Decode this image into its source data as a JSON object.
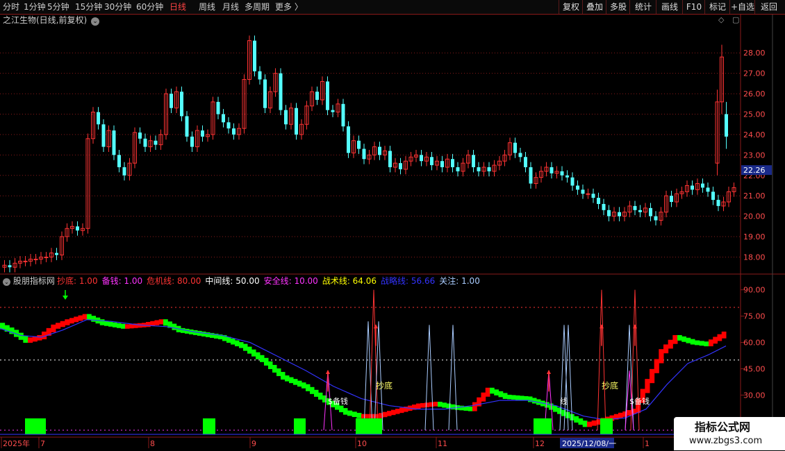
{
  "toolbar": {
    "periods": [
      {
        "label": "分时",
        "active": false
      },
      {
        "label": "1分钟",
        "active": false
      },
      {
        "label": "5分钟",
        "active": false
      },
      {
        "label": "15分钟",
        "active": false
      },
      {
        "label": "30分钟",
        "active": false
      },
      {
        "label": "60分钟",
        "active": false
      },
      {
        "label": "日线",
        "active": true
      },
      {
        "label": "周线",
        "active": false
      },
      {
        "label": "月线",
        "active": false
      },
      {
        "label": "多周期",
        "active": false
      },
      {
        "label": "更多 〉",
        "active": false
      }
    ],
    "right_buttons": [
      "复权",
      "叠加",
      "多股",
      "统计",
      "画线",
      "F10",
      "标记",
      "+自选",
      "返回"
    ]
  },
  "stock": {
    "title": "之江生物(日线,前复权)",
    "current_price": "22.26",
    "price_labels": [
      "28.00",
      "27.00",
      "26.00",
      "25.00",
      "24.00",
      "23.00",
      "22.00",
      "21.00",
      "20.00",
      "19.00",
      "18.00"
    ]
  },
  "indicator": {
    "name": "股朋指标网",
    "legend": [
      {
        "label": "抄底: 1.00",
        "color": "#ff3333"
      },
      {
        "label": "备钱: 1.00",
        "color": "#ff33ff"
      },
      {
        "label": "危机线: 80.00",
        "color": "#ff3333"
      },
      {
        "label": "中间线: 50.00",
        "color": "#ffffff"
      },
      {
        "label": "安全线: 10.00",
        "color": "#ff33ff"
      },
      {
        "label": "战术线: 64.06",
        "color": "#ffff00"
      },
      {
        "label": "战略线: 56.66",
        "color": "#3333ff"
      },
      {
        "label": "关注: 1.00",
        "color": "#aaccff"
      }
    ],
    "axis_labels": [
      "90.00",
      "75.00",
      "60.00",
      "45.00",
      "30.00",
      "15.00"
    ],
    "annotations": [
      "抄底",
      "抄底",
      "$备钱",
      "线",
      "$备钱"
    ]
  },
  "dates": [
    "2025年",
    "7",
    "8",
    "9",
    "10",
    "11",
    "12",
    "2025/12/08/一",
    "1"
  ],
  "watermark": {
    "line1": "指标公式网",
    "line2": "www.zbgs3.com"
  },
  "colors": {
    "up": "#ff3333",
    "down": "#54ffff",
    "green": "#00ff00",
    "red": "#ff0000",
    "blue": "#3333ff",
    "grid": "#8a1a1a"
  },
  "chart_data": {
    "type": "candlestick",
    "title": "之江生物(日线,前复权)",
    "ylim": [
      17.2,
      29.3
    ],
    "y_ticks": [
      18,
      19,
      20,
      21,
      22,
      23,
      24,
      25,
      26,
      27,
      28
    ],
    "last_price": 22.26,
    "candles": [
      {
        "o": 17.5,
        "c": 17.6
      },
      {
        "o": 17.6,
        "c": 17.5
      },
      {
        "o": 17.5,
        "c": 17.7
      },
      {
        "o": 17.7,
        "c": 17.8
      },
      {
        "o": 17.8,
        "c": 17.8
      },
      {
        "o": 17.8,
        "c": 17.9
      },
      {
        "o": 17.9,
        "c": 17.9
      },
      {
        "o": 17.9,
        "c": 18.0
      },
      {
        "o": 18.0,
        "c": 18.0
      },
      {
        "o": 18.0,
        "c": 18.2
      },
      {
        "o": 18.2,
        "c": 18.1
      },
      {
        "o": 18.1,
        "c": 19.0
      },
      {
        "o": 19.0,
        "c": 19.4
      },
      {
        "o": 19.4,
        "c": 19.5
      },
      {
        "o": 19.5,
        "c": 19.3
      },
      {
        "o": 19.3,
        "c": 19.4
      },
      {
        "o": 19.4,
        "c": 23.8
      },
      {
        "o": 23.8,
        "c": 25.1
      },
      {
        "o": 25.1,
        "c": 24.5
      },
      {
        "o": 24.5,
        "c": 23.4
      },
      {
        "o": 23.4,
        "c": 24.2
      },
      {
        "o": 24.2,
        "c": 23.0
      },
      {
        "o": 23.0,
        "c": 22.4
      },
      {
        "o": 22.4,
        "c": 22.0
      },
      {
        "o": 22.0,
        "c": 22.6
      },
      {
        "o": 22.6,
        "c": 24.1
      },
      {
        "o": 24.1,
        "c": 23.8
      },
      {
        "o": 23.8,
        "c": 23.4
      },
      {
        "o": 23.4,
        "c": 23.7
      },
      {
        "o": 23.7,
        "c": 23.5
      },
      {
        "o": 23.5,
        "c": 24.0
      },
      {
        "o": 24.0,
        "c": 26.0
      },
      {
        "o": 26.0,
        "c": 25.3
      },
      {
        "o": 25.3,
        "c": 26.1
      },
      {
        "o": 26.1,
        "c": 24.9
      },
      {
        "o": 24.9,
        "c": 23.9
      },
      {
        "o": 23.9,
        "c": 23.4
      },
      {
        "o": 23.4,
        "c": 24.2
      },
      {
        "o": 24.2,
        "c": 23.9
      },
      {
        "o": 23.9,
        "c": 24.0
      },
      {
        "o": 24.0,
        "c": 25.6
      },
      {
        "o": 25.6,
        "c": 25.0
      },
      {
        "o": 25.0,
        "c": 24.6
      },
      {
        "o": 24.6,
        "c": 24.3
      },
      {
        "o": 24.3,
        "c": 24.0
      },
      {
        "o": 24.0,
        "c": 24.3
      },
      {
        "o": 24.3,
        "c": 26.7
      },
      {
        "o": 26.7,
        "c": 28.6
      },
      {
        "o": 28.6,
        "c": 27.1
      },
      {
        "o": 27.1,
        "c": 26.7
      },
      {
        "o": 26.7,
        "c": 25.3
      },
      {
        "o": 25.3,
        "c": 26.1
      },
      {
        "o": 26.1,
        "c": 27.0
      },
      {
        "o": 27.0,
        "c": 25.2
      },
      {
        "o": 25.2,
        "c": 24.5
      },
      {
        "o": 24.5,
        "c": 25.3
      },
      {
        "o": 25.3,
        "c": 24.0
      },
      {
        "o": 24.0,
        "c": 24.5
      },
      {
        "o": 24.5,
        "c": 25.4
      },
      {
        "o": 25.4,
        "c": 26.1
      },
      {
        "o": 26.1,
        "c": 25.7
      },
      {
        "o": 25.7,
        "c": 26.6
      },
      {
        "o": 26.6,
        "c": 25.2
      },
      {
        "o": 25.2,
        "c": 25.1
      },
      {
        "o": 25.1,
        "c": 25.5
      },
      {
        "o": 25.5,
        "c": 24.4
      },
      {
        "o": 24.4,
        "c": 23.1
      },
      {
        "o": 23.1,
        "c": 23.7
      },
      {
        "o": 23.7,
        "c": 23.3
      },
      {
        "o": 23.3,
        "c": 22.8
      },
      {
        "o": 22.8,
        "c": 23.0
      },
      {
        "o": 23.0,
        "c": 23.4
      },
      {
        "o": 23.4,
        "c": 23.0
      },
      {
        "o": 23.0,
        "c": 23.2
      },
      {
        "o": 23.2,
        "c": 22.4
      },
      {
        "o": 22.4,
        "c": 22.6
      },
      {
        "o": 22.6,
        "c": 22.3
      },
      {
        "o": 22.3,
        "c": 22.7
      },
      {
        "o": 22.7,
        "c": 22.9
      },
      {
        "o": 22.9,
        "c": 23.0
      },
      {
        "o": 23.0,
        "c": 22.7
      },
      {
        "o": 22.7,
        "c": 22.9
      },
      {
        "o": 22.9,
        "c": 22.5
      },
      {
        "o": 22.5,
        "c": 22.7
      },
      {
        "o": 22.7,
        "c": 22.4
      },
      {
        "o": 22.4,
        "c": 22.8
      },
      {
        "o": 22.8,
        "c": 22.4
      },
      {
        "o": 22.4,
        "c": 22.2
      },
      {
        "o": 22.2,
        "c": 22.6
      },
      {
        "o": 22.6,
        "c": 23.0
      },
      {
        "o": 23.0,
        "c": 22.4
      },
      {
        "o": 22.4,
        "c": 22.2
      },
      {
        "o": 22.2,
        "c": 22.4
      },
      {
        "o": 22.4,
        "c": 22.2
      },
      {
        "o": 22.2,
        "c": 22.5
      },
      {
        "o": 22.5,
        "c": 22.7
      },
      {
        "o": 22.7,
        "c": 23.0
      },
      {
        "o": 23.0,
        "c": 23.6
      },
      {
        "o": 23.6,
        "c": 23.1
      },
      {
        "o": 23.1,
        "c": 22.9
      },
      {
        "o": 22.9,
        "c": 22.4
      },
      {
        "o": 22.4,
        "c": 21.6
      },
      {
        "o": 21.6,
        "c": 21.9
      },
      {
        "o": 21.9,
        "c": 22.2
      },
      {
        "o": 22.2,
        "c": 22.4
      },
      {
        "o": 22.4,
        "c": 22.1
      },
      {
        "o": 22.1,
        "c": 22.2
      },
      {
        "o": 22.2,
        "c": 22.0
      },
      {
        "o": 22.0,
        "c": 21.9
      },
      {
        "o": 21.9,
        "c": 21.5
      },
      {
        "o": 21.5,
        "c": 21.3
      },
      {
        "o": 21.3,
        "c": 21.1
      },
      {
        "o": 21.1,
        "c": 21.1
      },
      {
        "o": 21.1,
        "c": 20.9
      },
      {
        "o": 20.9,
        "c": 20.6
      },
      {
        "o": 20.6,
        "c": 20.3
      },
      {
        "o": 20.3,
        "c": 20.0
      },
      {
        "o": 20.0,
        "c": 20.2
      },
      {
        "o": 20.2,
        "c": 20.0
      },
      {
        "o": 20.0,
        "c": 20.2
      },
      {
        "o": 20.2,
        "c": 20.5
      },
      {
        "o": 20.5,
        "c": 20.3
      },
      {
        "o": 20.3,
        "c": 20.2
      },
      {
        "o": 20.2,
        "c": 20.4
      },
      {
        "o": 20.4,
        "c": 20.0
      },
      {
        "o": 20.0,
        "c": 19.8
      },
      {
        "o": 19.8,
        "c": 20.2
      },
      {
        "o": 20.2,
        "c": 21.0
      },
      {
        "o": 21.0,
        "c": 20.7
      },
      {
        "o": 20.7,
        "c": 21.1
      },
      {
        "o": 21.1,
        "c": 21.2
      },
      {
        "o": 21.2,
        "c": 21.5
      },
      {
        "o": 21.5,
        "c": 21.3
      },
      {
        "o": 21.3,
        "c": 21.6
      },
      {
        "o": 21.6,
        "c": 21.4
      },
      {
        "o": 21.4,
        "c": 21.2
      },
      {
        "o": 21.2,
        "c": 20.8
      },
      {
        "o": 20.8,
        "c": 20.5
      },
      {
        "o": 20.5,
        "c": 20.7
      },
      {
        "o": 20.7,
        "c": 21.2
      },
      {
        "o": 21.2,
        "c": 21.4
      }
    ],
    "recent_candles": [
      {
        "o": 22.6,
        "c": 25.6
      },
      {
        "o": 25.6,
        "c": 27.8
      },
      {
        "o": 25.0,
        "c": 23.9
      }
    ]
  }
}
